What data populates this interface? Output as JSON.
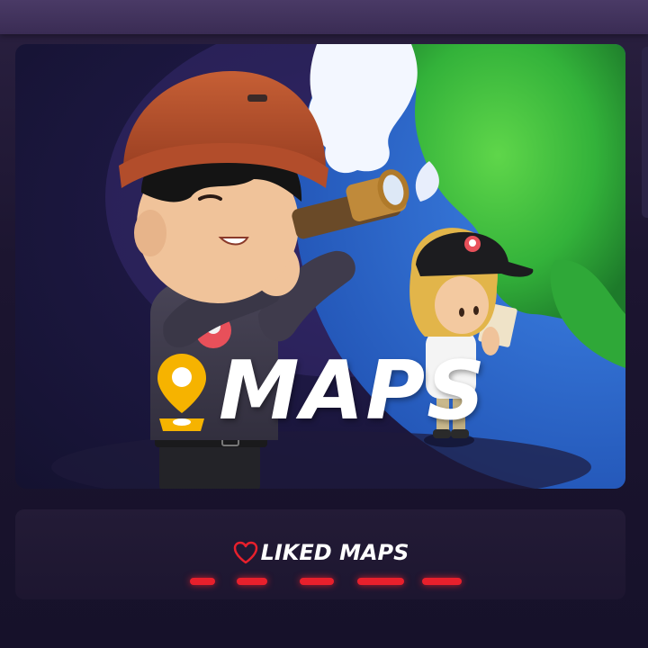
{
  "maps_card": {
    "title": "MAPS",
    "icon": "map-pin-icon",
    "accent_color": "#f6b300"
  },
  "liked_maps": {
    "title": "LIKED MAPS",
    "icon": "heart-outline-icon",
    "accent_color": "#e8202c"
  }
}
